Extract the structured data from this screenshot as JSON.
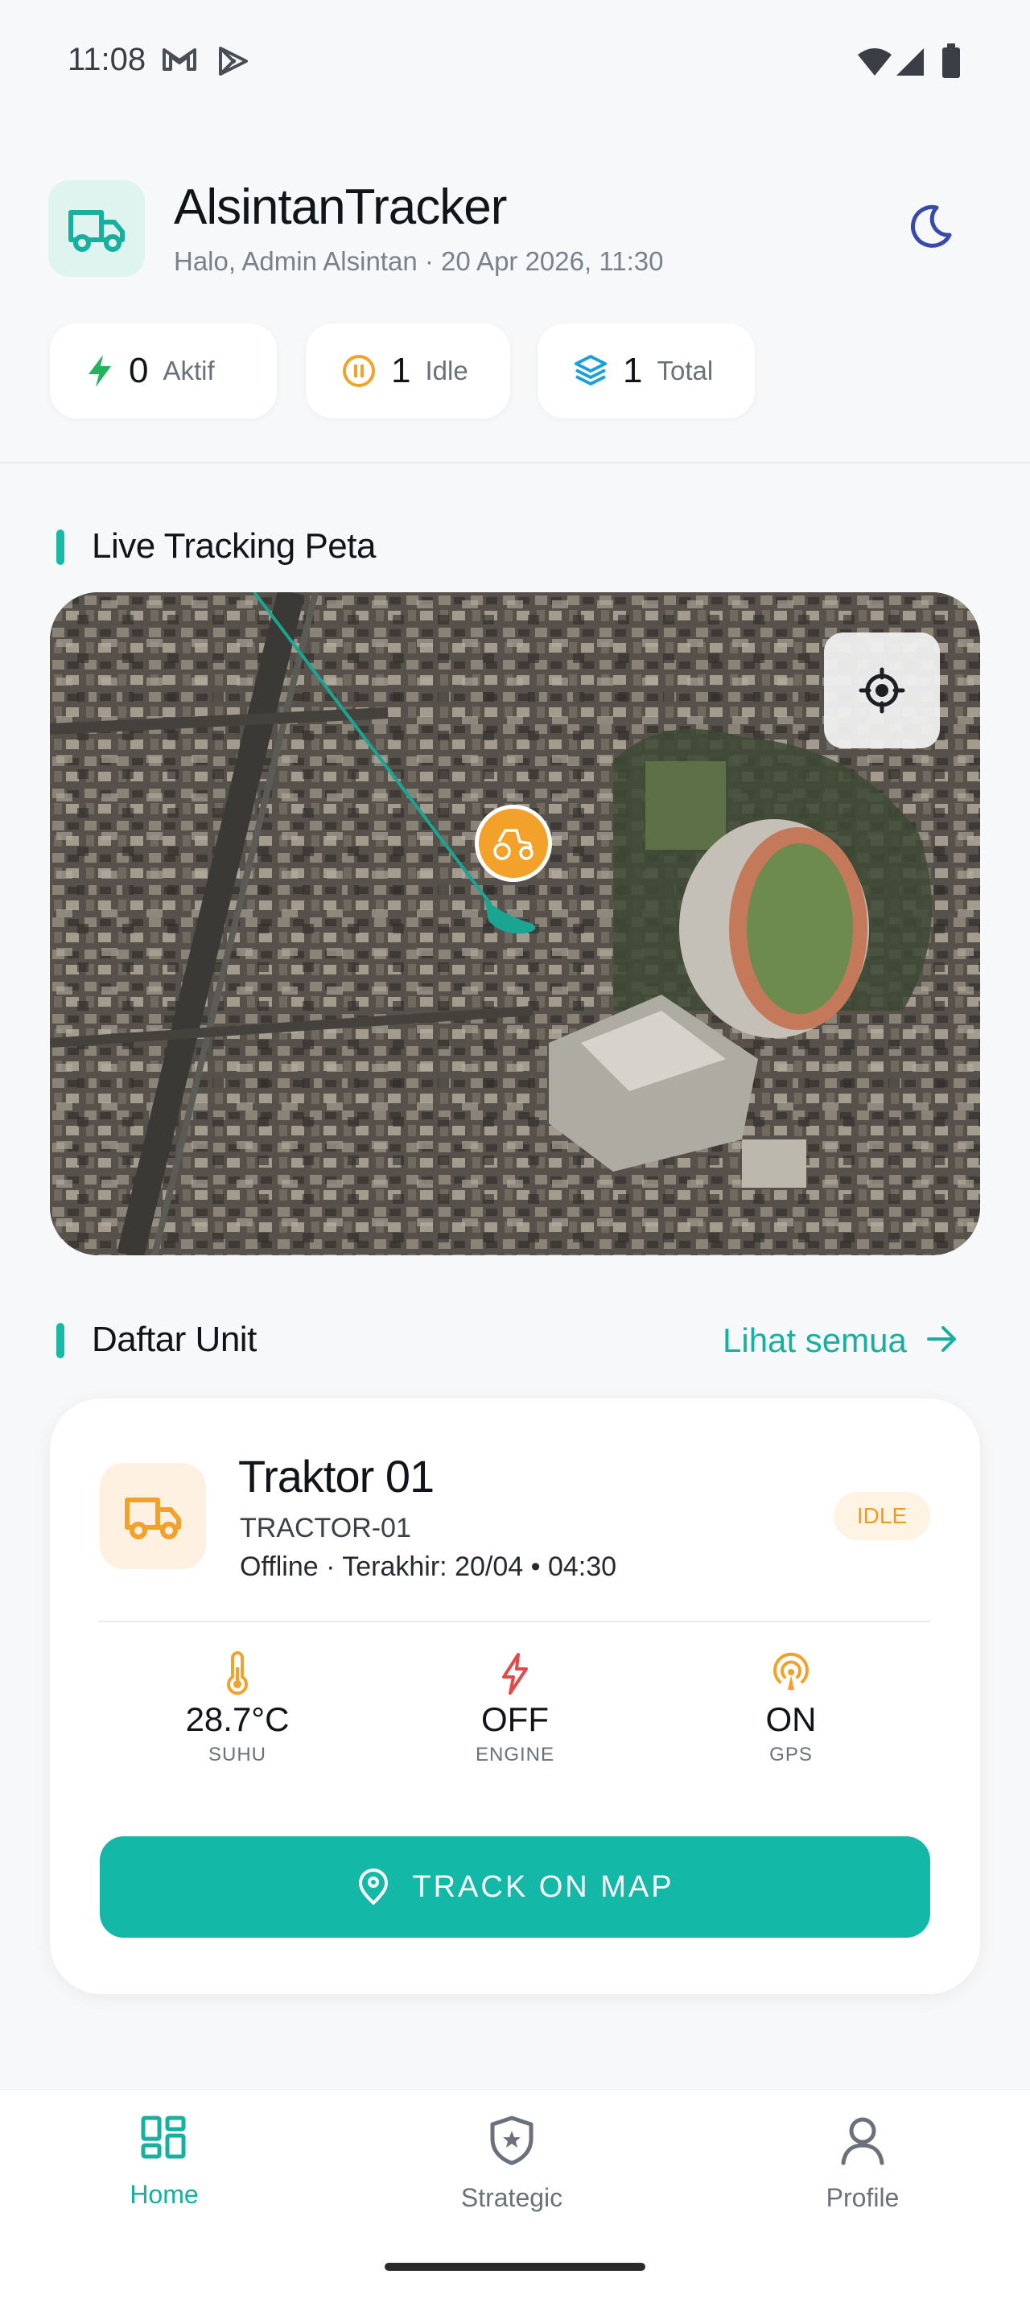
{
  "status_bar": {
    "time": "11:08",
    "icons": [
      "gmail-icon",
      "play-store-icon",
      "wifi-icon",
      "signal-icon",
      "battery-icon"
    ]
  },
  "header": {
    "title": "AlsintanTracker",
    "subtitle": "Halo, Admin Alsintan · 20 Apr 2026, 11:30",
    "logo_icon": "truck-icon",
    "theme_toggle_icon": "moon-icon"
  },
  "stats": [
    {
      "count": "0",
      "label": "Aktif",
      "icon": "bolt-icon",
      "color": "#22b35e"
    },
    {
      "count": "1",
      "label": "Idle",
      "icon": "pause-icon",
      "color": "#f2a22b"
    },
    {
      "count": "1",
      "label": "Total",
      "icon": "layers-icon",
      "color": "#1aa2d8"
    }
  ],
  "map_section": {
    "title": "Live Tracking Peta",
    "locate_icon": "crosshair-icon",
    "marker_icon": "tractor-icon"
  },
  "units_section": {
    "title": "Daftar Unit",
    "see_all": "Lihat semua"
  },
  "unit": {
    "name": "Traktor 01",
    "code": "TRACTOR-01",
    "status_line": "Offline · Terakhir: 20/04 • 04:30",
    "badge": "IDLE",
    "metrics": [
      {
        "value": "28.7°C",
        "caption": "SUHU",
        "icon": "thermometer-icon",
        "color": "#f2a22b"
      },
      {
        "value": "OFF",
        "caption": "ENGINE",
        "icon": "bolt-outline-icon",
        "color": "#e54848"
      },
      {
        "value": "ON",
        "caption": "GPS",
        "icon": "gps-signal-icon",
        "color": "#f2a22b"
      }
    ],
    "track_button": "TRACK ON MAP"
  },
  "nav": [
    {
      "label": "Home",
      "icon": "dashboard-icon",
      "active": true
    },
    {
      "label": "Strategic",
      "icon": "shield-star-icon",
      "active": false
    },
    {
      "label": "Profile",
      "icon": "person-icon",
      "active": false
    }
  ],
  "colors": {
    "accent": "#14b8a6",
    "background": "#f7f8fa",
    "idle": "#f2a22b"
  }
}
